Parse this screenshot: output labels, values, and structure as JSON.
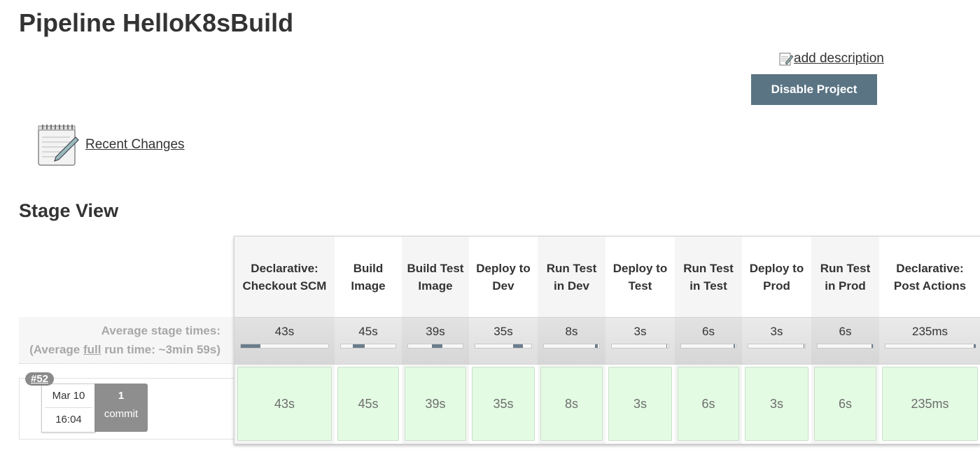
{
  "page_title": "Pipeline HelloK8sBuild",
  "add_description": "add description",
  "disable_button": "Disable Project",
  "recent_changes": "Recent Changes",
  "stage_view_heading": "Stage View",
  "avg_stage_times_label": "Average stage times:",
  "avg_full_run": {
    "prefix": "(Average ",
    "full": "full",
    "suffix": " run time: ~3min 59s)"
  },
  "build": {
    "number": "#52",
    "date": "Mar 10",
    "time": "16:04",
    "commit_count": "1",
    "commit_label": "commit"
  },
  "stages": [
    {
      "name": "Declarative: Checkout SCM",
      "avg": "43s",
      "progress": [
        0.0,
        0.22
      ],
      "cell": "43s",
      "shaded": true
    },
    {
      "name": "Build Image",
      "avg": "45s",
      "progress": [
        0.22,
        0.44
      ],
      "cell": "45s",
      "shaded": false
    },
    {
      "name": "Build Test Image",
      "avg": "39s",
      "progress": [
        0.44,
        0.63
      ],
      "cell": "39s",
      "shaded": true
    },
    {
      "name": "Deploy to Dev",
      "avg": "35s",
      "progress": [
        0.68,
        0.85
      ],
      "cell": "35s",
      "shaded": false
    },
    {
      "name": "Run Test in Dev",
      "avg": "8s",
      "progress": [
        0.93,
        0.97
      ],
      "cell": "8s",
      "shaded": true
    },
    {
      "name": "Deploy to Test",
      "avg": "3s",
      "progress": [
        0.96,
        0.98
      ],
      "cell": "3s",
      "shaded": false
    },
    {
      "name": "Run Test in Test",
      "avg": "6s",
      "progress": [
        0.96,
        0.99
      ],
      "cell": "6s",
      "shaded": true
    },
    {
      "name": "Deploy to Prod",
      "avg": "3s",
      "progress": [
        0.97,
        0.99
      ],
      "cell": "3s",
      "shaded": false
    },
    {
      "name": "Run Test in Prod",
      "avg": "6s",
      "progress": [
        0.97,
        1.0
      ],
      "cell": "6s",
      "shaded": true
    },
    {
      "name": "Declarative: Post Actions",
      "avg": "235ms",
      "progress": [
        0.995,
        1.0
      ],
      "cell": "235ms",
      "shaded": false
    }
  ],
  "colors": {
    "button": "#5a7484",
    "success_cell": "#e3fbe3",
    "badge": "#8a8a8a"
  }
}
